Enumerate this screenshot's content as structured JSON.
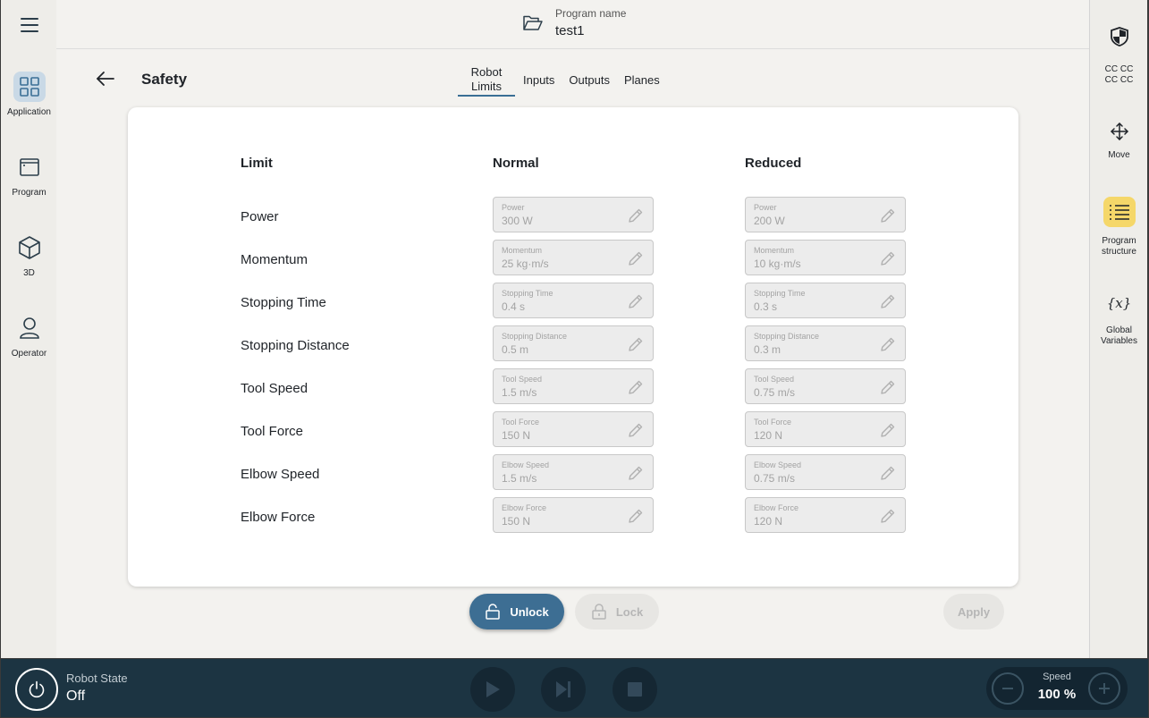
{
  "sidebar": {
    "items": [
      {
        "label": "Application",
        "icon": "grid-icon",
        "active": true
      },
      {
        "label": "Program",
        "icon": "program-window-icon",
        "active": false
      },
      {
        "label": "3D",
        "icon": "cube-icon",
        "active": false
      },
      {
        "label": "Operator",
        "icon": "user-icon",
        "active": false
      }
    ]
  },
  "topbar": {
    "program_label": "Program name",
    "program_name": "test1"
  },
  "header": {
    "title": "Safety",
    "tabs": [
      {
        "label": "Robot Limits",
        "active": true
      },
      {
        "label": "Inputs",
        "active": false
      },
      {
        "label": "Outputs",
        "active": false
      },
      {
        "label": "Planes",
        "active": false
      }
    ]
  },
  "limits": {
    "columns": {
      "limit": "Limit",
      "normal": "Normal",
      "reduced": "Reduced"
    },
    "rows": [
      {
        "label": "Power",
        "field": "Power",
        "normal": "300 W",
        "reduced": "200 W"
      },
      {
        "label": "Momentum",
        "field": "Momentum",
        "normal": "25 kg·m/s",
        "reduced": "10 kg·m/s"
      },
      {
        "label": "Stopping Time",
        "field": "Stopping Time",
        "normal": "0.4 s",
        "reduced": "0.3 s"
      },
      {
        "label": "Stopping Distance",
        "field": "Stopping Distance",
        "normal": "0.5 m",
        "reduced": "0.3 m"
      },
      {
        "label": "Tool Speed",
        "field": "Tool Speed",
        "normal": "1.5 m/s",
        "reduced": "0.75 m/s"
      },
      {
        "label": "Tool Force",
        "field": "Tool Force",
        "normal": "150 N",
        "reduced": "120 N"
      },
      {
        "label": "Elbow Speed",
        "field": "Elbow Speed",
        "normal": "1.5 m/s",
        "reduced": "0.75 m/s"
      },
      {
        "label": "Elbow Force",
        "field": "Elbow Force",
        "normal": "150 N",
        "reduced": "120 N"
      }
    ]
  },
  "actions": {
    "unlock": "Unlock",
    "lock": "Lock",
    "apply": "Apply"
  },
  "right_sidebar": {
    "items": [
      {
        "label": "CC CC CC CC",
        "icon": "safety-shield-icon"
      },
      {
        "label": "Move",
        "icon": "move-arrows-icon"
      },
      {
        "label": "Program structure",
        "icon": "list-icon",
        "active": true
      },
      {
        "label": "Global Variables",
        "icon": "variables-icon"
      }
    ]
  },
  "bottom": {
    "robot_state_label": "Robot State",
    "robot_state_value": "Off",
    "speed_label": "Speed",
    "speed_value": "100 %"
  },
  "colors": {
    "accent": "#3d6e93",
    "bottom_bar": "#1c3442",
    "highlight": "#f5d769",
    "active_nav": "#c9d9e6"
  }
}
